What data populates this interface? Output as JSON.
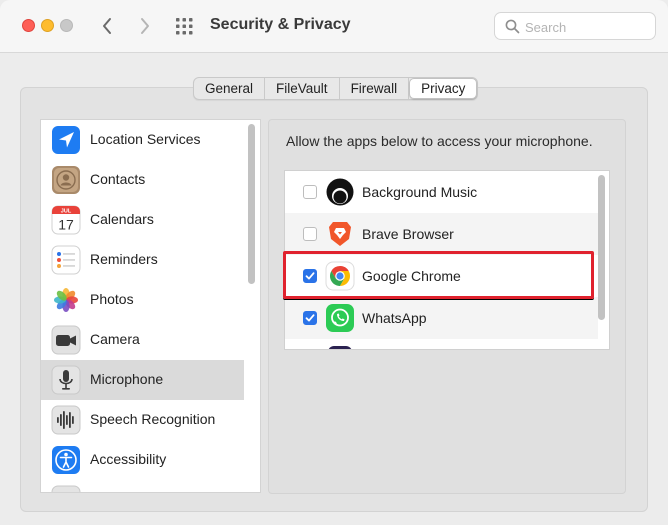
{
  "window": {
    "title": "Security & Privacy",
    "search_placeholder": "Search",
    "icons": [
      "close-button",
      "minimize-button",
      "maximize-button",
      "chevron-left-icon",
      "chevron-right-icon",
      "grid-icon",
      "search-icon"
    ]
  },
  "tabs": [
    {
      "label": "General",
      "active": false
    },
    {
      "label": "FileVault",
      "active": false
    },
    {
      "label": "Firewall",
      "active": false
    },
    {
      "label": "Privacy",
      "active": true
    }
  ],
  "sidebar": {
    "items": [
      {
        "label": "Location Services",
        "icon": "location-icon",
        "selected": false
      },
      {
        "label": "Contacts",
        "icon": "contacts-icon",
        "selected": false
      },
      {
        "label": "Calendars",
        "icon": "calendar-icon",
        "selected": false,
        "icon_month": "JUL",
        "icon_day": "17"
      },
      {
        "label": "Reminders",
        "icon": "reminders-icon",
        "selected": false
      },
      {
        "label": "Photos",
        "icon": "photos-icon",
        "selected": false
      },
      {
        "label": "Camera",
        "icon": "camera-icon",
        "selected": false
      },
      {
        "label": "Microphone",
        "icon": "microphone-icon",
        "selected": true
      },
      {
        "label": "Speech Recognition",
        "icon": "speech-recognition-icon",
        "selected": false
      },
      {
        "label": "Accessibility",
        "icon": "accessibility-icon",
        "selected": false
      }
    ]
  },
  "main": {
    "description": "Allow the apps below to access your microphone.",
    "apps": [
      {
        "name": "Background Music",
        "checked": false,
        "icon": "background-music-icon"
      },
      {
        "name": "Brave Browser",
        "checked": false,
        "icon": "brave-icon"
      },
      {
        "name": "Google Chrome",
        "checked": true,
        "icon": "chrome-icon",
        "highlighted": true
      },
      {
        "name": "WhatsApp",
        "checked": true,
        "icon": "whatsapp-icon"
      }
    ]
  },
  "colors": {
    "accent": "#2a73e8",
    "highlight": "#e0222e",
    "selected_row": "#dadada"
  }
}
